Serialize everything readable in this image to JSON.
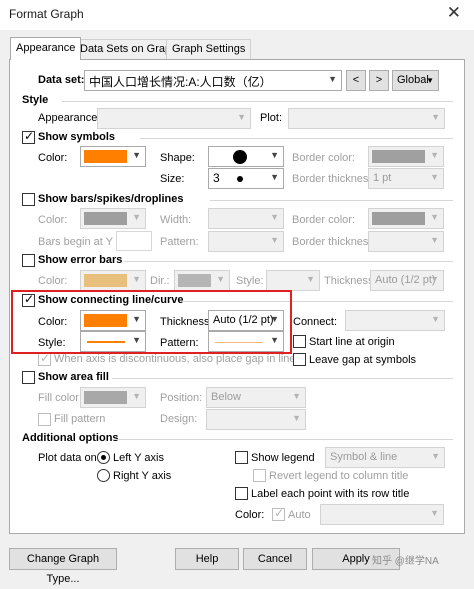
{
  "window": {
    "title": "Format Graph",
    "close": "✕"
  },
  "tabs": [
    "Appearance",
    "Data Sets on Graph",
    "Graph Settings"
  ],
  "dataset": {
    "label": "Data set:",
    "value": "中国人口增长情况:A:人口数（亿）",
    "prev": "<",
    "next": ">",
    "scope": "Global"
  },
  "style": {
    "title": "Style",
    "appearance_label": "Appearance:",
    "plot_label": "Plot:"
  },
  "symbols": {
    "title": "Show symbols",
    "checked": true,
    "color_label": "Color:",
    "color": "#ff7f00",
    "shape_label": "Shape:",
    "size_label": "Size:",
    "size": "3",
    "border_color_label": "Border color:",
    "border_thickness_label": "Border thickness:",
    "border_thickness": "1 pt"
  },
  "bars": {
    "title": "Show bars/spikes/droplines",
    "checked": false,
    "color_label": "Color:",
    "width_label": "Width:",
    "border_color_label": "Border color:",
    "begin_label": "Bars begin at Y =",
    "pattern_label": "Pattern:",
    "border_thickness_label": "Border thickness:"
  },
  "error_bars": {
    "title": "Show error bars",
    "checked": false,
    "color_label": "Color:",
    "color": "#e8bf7c",
    "dir_label": "Dir.:",
    "style_label": "Style:",
    "thickness_label": "Thickness",
    "thickness": "Auto (1/2 pt)"
  },
  "connecting": {
    "title": "Show connecting line/curve",
    "checked": true,
    "color_label": "Color:",
    "color": "#ff7f00",
    "thickness_label": "Thickness:",
    "thickness": "Auto (1/2 pt)",
    "style_label": "Style:",
    "pattern_label": "Pattern:",
    "pattern_color": "#f2b67a",
    "connect_label": "Connect:",
    "start_at_origin": "Start line at origin",
    "leave_gap": "Leave gap at symbols",
    "gap_note": "When axis is discontinuous, also place gap in line"
  },
  "area_fill": {
    "title": "Show area fill",
    "checked": false,
    "fill_color_label": "Fill color:",
    "position_label": "Position:",
    "position": "Below",
    "fill_pattern": "Fill pattern",
    "design_label": "Design:"
  },
  "additional": {
    "title": "Additional options",
    "plot_data_on": "Plot data on:",
    "left_axis": "Left Y axis",
    "right_axis": "Right  Y axis",
    "show_legend": "Show legend",
    "legend_style": "Symbol & line",
    "revert_legend": "Revert legend to column title",
    "label_points": "Label each point with its row title",
    "color_label": "Color:",
    "auto": "Auto"
  },
  "buttons": {
    "change_type": "Change Graph Type...",
    "help": "Help",
    "cancel": "Cancel",
    "apply": "Apply"
  },
  "watermark": "知乎 @继学NA"
}
